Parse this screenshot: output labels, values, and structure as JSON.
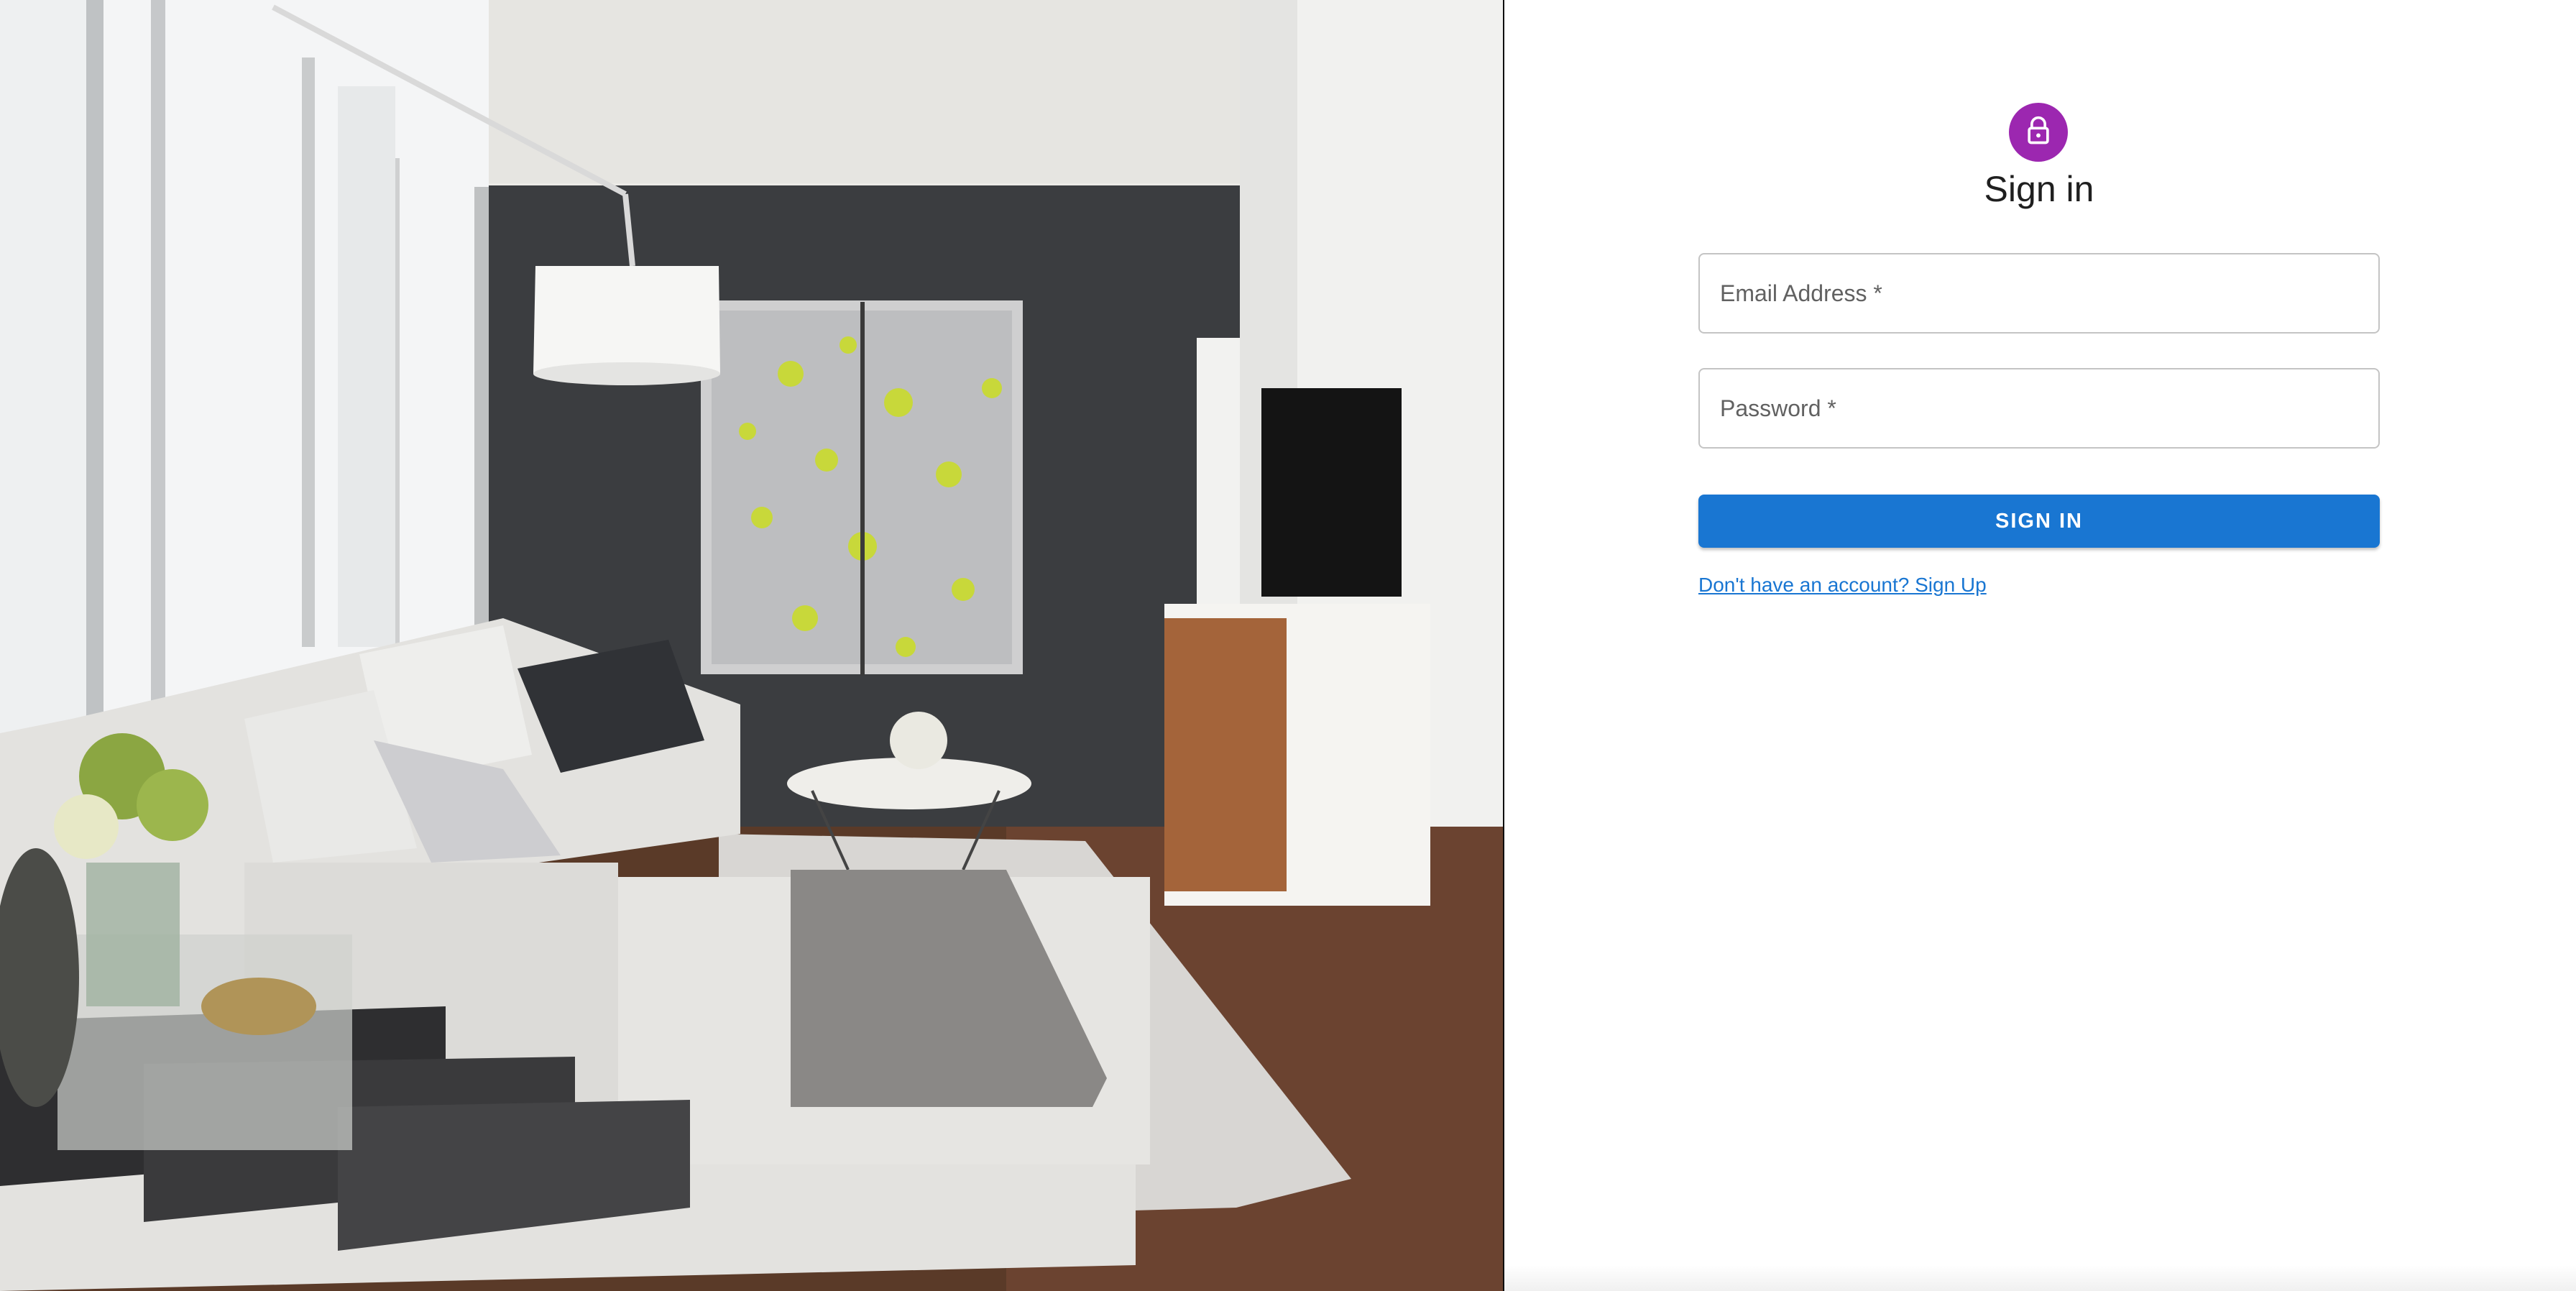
{
  "hero": {
    "image_alt": "living room photo",
    "icon": "living-room-photo"
  },
  "signin": {
    "icon": "lock-icon",
    "icon_bg": "#9c27b0",
    "title": "Sign in",
    "email_placeholder": "Email Address *",
    "email_value": "",
    "password_placeholder": "Password *",
    "password_value": "",
    "submit_label": "SIGN IN",
    "submit_color": "#1976d2",
    "signup_link": "Don't have an account? Sign Up"
  }
}
